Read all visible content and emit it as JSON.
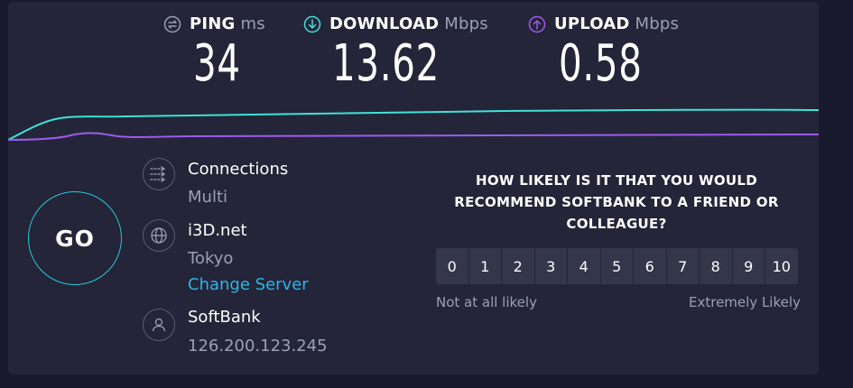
{
  "metrics": {
    "ping": {
      "label": "PING",
      "unit": "ms",
      "value": "34",
      "icon": "ping-icon"
    },
    "download": {
      "label": "DOWNLOAD",
      "unit": "Mbps",
      "value": "13.62",
      "icon": "download-arrow-icon"
    },
    "upload": {
      "label": "UPLOAD",
      "unit": "Mbps",
      "value": "0.58",
      "icon": "upload-arrow-icon"
    }
  },
  "colors": {
    "download": "#3ee2d9",
    "upload": "#9a5cf0",
    "link": "#2fb3ea",
    "go_ring": "#27c6d8"
  },
  "go_button": {
    "label": "GO"
  },
  "connection": {
    "connections": {
      "title": "Connections",
      "value": "Multi",
      "icon": "connections-icon"
    },
    "server": {
      "title": "i3D.net",
      "location": "Tokyo",
      "change_label": "Change Server",
      "icon": "globe-icon"
    },
    "provider": {
      "title": "SoftBank",
      "ip": "126.200.123.245",
      "icon": "user-icon"
    }
  },
  "survey": {
    "question": "HOW LIKELY IS IT THAT YOU WOULD RECOMMEND SOFTBANK TO A FRIEND OR COLLEAGUE?",
    "scale": [
      "0",
      "1",
      "2",
      "3",
      "4",
      "5",
      "6",
      "7",
      "8",
      "9",
      "10"
    ],
    "low_label": "Not at all likely",
    "high_label": "Extremely Likely"
  }
}
